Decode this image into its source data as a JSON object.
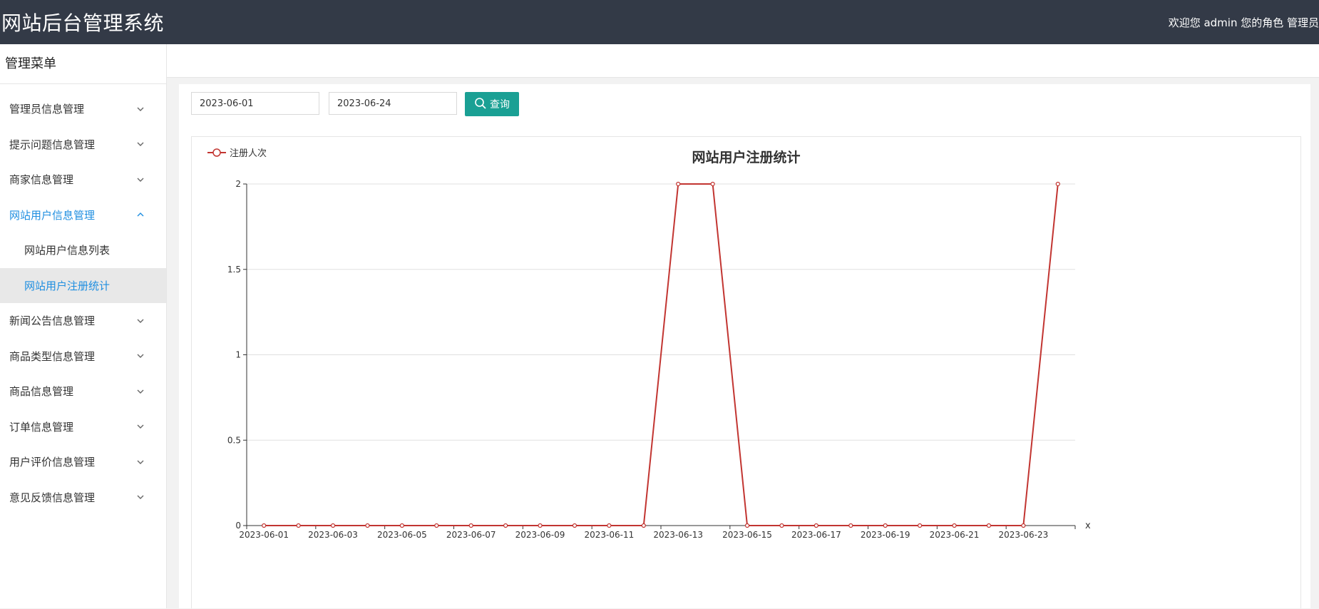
{
  "header": {
    "app_title": "网站后台管理系统",
    "welcome_text": "欢迎您 admin 您的角色 管理员"
  },
  "sidebar": {
    "title": "管理菜单",
    "items": [
      {
        "label": "管理员信息管理",
        "expanded": false
      },
      {
        "label": "提示问题信息管理",
        "expanded": false
      },
      {
        "label": "商家信息管理",
        "expanded": false
      },
      {
        "label": "网站用户信息管理",
        "expanded": true,
        "children": [
          {
            "label": "网站用户信息列表",
            "selected": false
          },
          {
            "label": "网站用户注册统计",
            "selected": true
          }
        ]
      },
      {
        "label": "新闻公告信息管理",
        "expanded": false
      },
      {
        "label": "商品类型信息管理",
        "expanded": false
      },
      {
        "label": "商品信息管理",
        "expanded": false
      },
      {
        "label": "订单信息管理",
        "expanded": false
      },
      {
        "label": "用户评价信息管理",
        "expanded": false
      },
      {
        "label": "意见反馈信息管理",
        "expanded": false
      }
    ]
  },
  "filter": {
    "start_date": "2023-06-01",
    "end_date": "2023-06-24",
    "query_label": "查询"
  },
  "colors": {
    "topbar": "#333a47",
    "accent": "#1e8ee0",
    "button": "#1aa094",
    "series": "#c23531"
  },
  "chart_data": {
    "type": "line",
    "title": "网站用户注册统计",
    "legend": "注册人次",
    "legend_position": "top-left",
    "xlabel": "x",
    "ylabel": "",
    "grid": true,
    "ylim": [
      0,
      2
    ],
    "yticks": [
      "0",
      "0.5",
      "1",
      "1.5",
      "2"
    ],
    "x": [
      "2023-06-01",
      "2023-06-02",
      "2023-06-03",
      "2023-06-04",
      "2023-06-05",
      "2023-06-06",
      "2023-06-07",
      "2023-06-08",
      "2023-06-09",
      "2023-06-10",
      "2023-06-11",
      "2023-06-12",
      "2023-06-13",
      "2023-06-14",
      "2023-06-15",
      "2023-06-16",
      "2023-06-17",
      "2023-06-18",
      "2023-06-19",
      "2023-06-20",
      "2023-06-21",
      "2023-06-22",
      "2023-06-23",
      "2023-06-24"
    ],
    "x_tick_labels": [
      "2023-06-01",
      "2023-06-03",
      "2023-06-05",
      "2023-06-07",
      "2023-06-09",
      "2023-06-11",
      "2023-06-13",
      "2023-06-15",
      "2023-06-17",
      "2023-06-19",
      "2023-06-21",
      "2023-06-23"
    ],
    "series": [
      {
        "name": "注册人次",
        "values": [
          0,
          0,
          0,
          0,
          0,
          0,
          0,
          0,
          0,
          0,
          0,
          0,
          2,
          2,
          0,
          0,
          0,
          0,
          0,
          0,
          0,
          0,
          0,
          2
        ]
      }
    ]
  }
}
